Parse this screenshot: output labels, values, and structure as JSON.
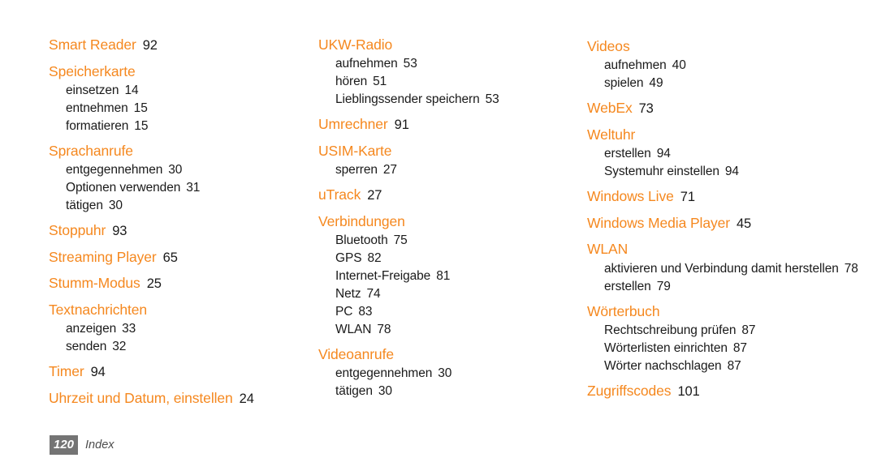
{
  "document": {
    "type": "index",
    "accent_color": "#f5881f",
    "text_color": "#1a1a1a",
    "background_color": "#ffffff"
  },
  "footer": {
    "page_number": "120",
    "section_label": "Index",
    "badge_color": "#747474",
    "label_color": "#4d4d4d"
  },
  "columns": [
    {
      "id": "column-1",
      "groups": [
        {
          "head": {
            "text": "Smart Reader",
            "page": "92"
          },
          "subs": []
        },
        {
          "head": {
            "text": "Speicherkarte",
            "page": ""
          },
          "subs": [
            {
              "text": "einsetzen",
              "page": "14"
            },
            {
              "text": "entnehmen",
              "page": "15"
            },
            {
              "text": "formatieren",
              "page": "15"
            }
          ]
        },
        {
          "head": {
            "text": "Sprachanrufe",
            "page": ""
          },
          "subs": [
            {
              "text": "entgegennehmen",
              "page": "30"
            },
            {
              "text": "Optionen verwenden",
              "page": "31"
            },
            {
              "text": "tätigen",
              "page": "30"
            }
          ]
        },
        {
          "head": {
            "text": "Stoppuhr",
            "page": "93"
          },
          "subs": []
        },
        {
          "head": {
            "text": "Streaming Player",
            "page": "65"
          },
          "subs": []
        },
        {
          "head": {
            "text": "Stumm-Modus",
            "page": "25"
          },
          "subs": []
        },
        {
          "head": {
            "text": "Textnachrichten",
            "page": ""
          },
          "subs": [
            {
              "text": "anzeigen",
              "page": "33"
            },
            {
              "text": "senden",
              "page": "32"
            }
          ]
        },
        {
          "head": {
            "text": "Timer",
            "page": "94"
          },
          "subs": []
        },
        {
          "head": {
            "text": "Uhrzeit und Datum, einstellen",
            "page": "24"
          },
          "subs": []
        }
      ]
    },
    {
      "id": "column-2",
      "groups": [
        {
          "head": {
            "text": "UKW-Radio",
            "page": ""
          },
          "subs": [
            {
              "text": "aufnehmen",
              "page": "53"
            },
            {
              "text": "hören",
              "page": "51"
            },
            {
              "text": "Lieblingssender speichern",
              "page": "53"
            }
          ]
        },
        {
          "head": {
            "text": "Umrechner",
            "page": "91"
          },
          "subs": []
        },
        {
          "head": {
            "text": "USIM-Karte",
            "page": ""
          },
          "subs": [
            {
              "text": "sperren",
              "page": "27"
            }
          ]
        },
        {
          "head": {
            "text": "uTrack",
            "page": "27"
          },
          "subs": []
        },
        {
          "head": {
            "text": "Verbindungen",
            "page": ""
          },
          "subs": [
            {
              "text": "Bluetooth",
              "page": "75"
            },
            {
              "text": "GPS",
              "page": "82"
            },
            {
              "text": "Internet-Freigabe",
              "page": "81"
            },
            {
              "text": "Netz",
              "page": "74"
            },
            {
              "text": "PC",
              "page": "83"
            },
            {
              "text": "WLAN",
              "page": "78"
            }
          ]
        },
        {
          "head": {
            "text": "Videoanrufe",
            "page": ""
          },
          "subs": [
            {
              "text": "entgegennehmen",
              "page": "30"
            },
            {
              "text": "tätigen",
              "page": "30"
            }
          ]
        }
      ]
    },
    {
      "id": "column-3",
      "groups": [
        {
          "head": {
            "text": "Videos",
            "page": ""
          },
          "subs": [
            {
              "text": "aufnehmen",
              "page": "40"
            },
            {
              "text": "spielen",
              "page": "49"
            }
          ]
        },
        {
          "head": {
            "text": "WebEx",
            "page": "73"
          },
          "subs": []
        },
        {
          "head": {
            "text": "Weltuhr",
            "page": ""
          },
          "subs": [
            {
              "text": "erstellen",
              "page": "94"
            },
            {
              "text": "Systemuhr einstellen",
              "page": "94"
            }
          ]
        },
        {
          "head": {
            "text": "Windows Live",
            "page": "71"
          },
          "subs": []
        },
        {
          "head": {
            "text": "Windows Media Player",
            "page": "45"
          },
          "subs": []
        },
        {
          "head": {
            "text": "WLAN",
            "page": ""
          },
          "subs": [
            {
              "text": "aktivieren und Verbindung damit herstellen",
              "page": "78",
              "wrap": true
            },
            {
              "text": "erstellen",
              "page": "79"
            }
          ]
        },
        {
          "head": {
            "text": "Wörterbuch",
            "page": ""
          },
          "subs": [
            {
              "text": "Rechtschreibung prüfen",
              "page": "87"
            },
            {
              "text": "Wörterlisten einrichten",
              "page": "87"
            },
            {
              "text": "Wörter nachschlagen",
              "page": "87"
            }
          ]
        },
        {
          "head": {
            "text": "Zugriffscodes",
            "page": "101"
          },
          "subs": []
        }
      ]
    }
  ]
}
